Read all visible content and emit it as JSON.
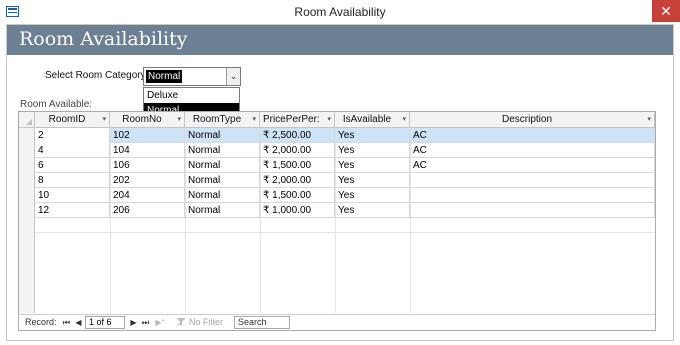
{
  "window": {
    "title": "Room Availability",
    "close_glyph": "✕"
  },
  "form": {
    "title": "Room Availability",
    "category_label": "Select Room Category:",
    "category_value": "Normal",
    "combo_arrow": "⌄",
    "dropdown_options": [
      "Deluxe",
      "Normal"
    ],
    "dropdown_selected": "Normal",
    "subform_label": "Room Available:"
  },
  "datasheet": {
    "columns": [
      "RoomID",
      "RoomNo",
      "RoomType",
      "PricePerPer:",
      "IsAvailable",
      "Description"
    ],
    "sort_arrow": "▾",
    "rows": [
      [
        "2",
        "102",
        "Normal",
        "₹ 2,500.00",
        "Yes",
        "AC"
      ],
      [
        "4",
        "104",
        "Normal",
        "₹ 2,000.00",
        "Yes",
        "AC"
      ],
      [
        "6",
        "106",
        "Normal",
        "₹ 1,500.00",
        "Yes",
        "AC"
      ],
      [
        "8",
        "202",
        "Normal",
        "₹ 2,000.00",
        "Yes",
        ""
      ],
      [
        "10",
        "204",
        "Normal",
        "₹ 1,500.00",
        "Yes",
        ""
      ],
      [
        "12",
        "206",
        "Normal",
        "₹ 1,000.00",
        "Yes",
        ""
      ]
    ],
    "selected_row_index": 0
  },
  "navigation": {
    "record_label": "Record:",
    "first_glyph": "⏮",
    "prev_glyph": "◀",
    "next_glyph": "▶",
    "last_glyph": "⏭",
    "new_glyph": "▶*",
    "current_record": "1 of 6",
    "filter_icon": "funnel-icon",
    "filter_text": "No Filter",
    "search_text": "Search"
  },
  "colors": {
    "header_band": "#6d7f93",
    "close_button": "#c7403a",
    "selected_row": "#cfe3f8"
  }
}
